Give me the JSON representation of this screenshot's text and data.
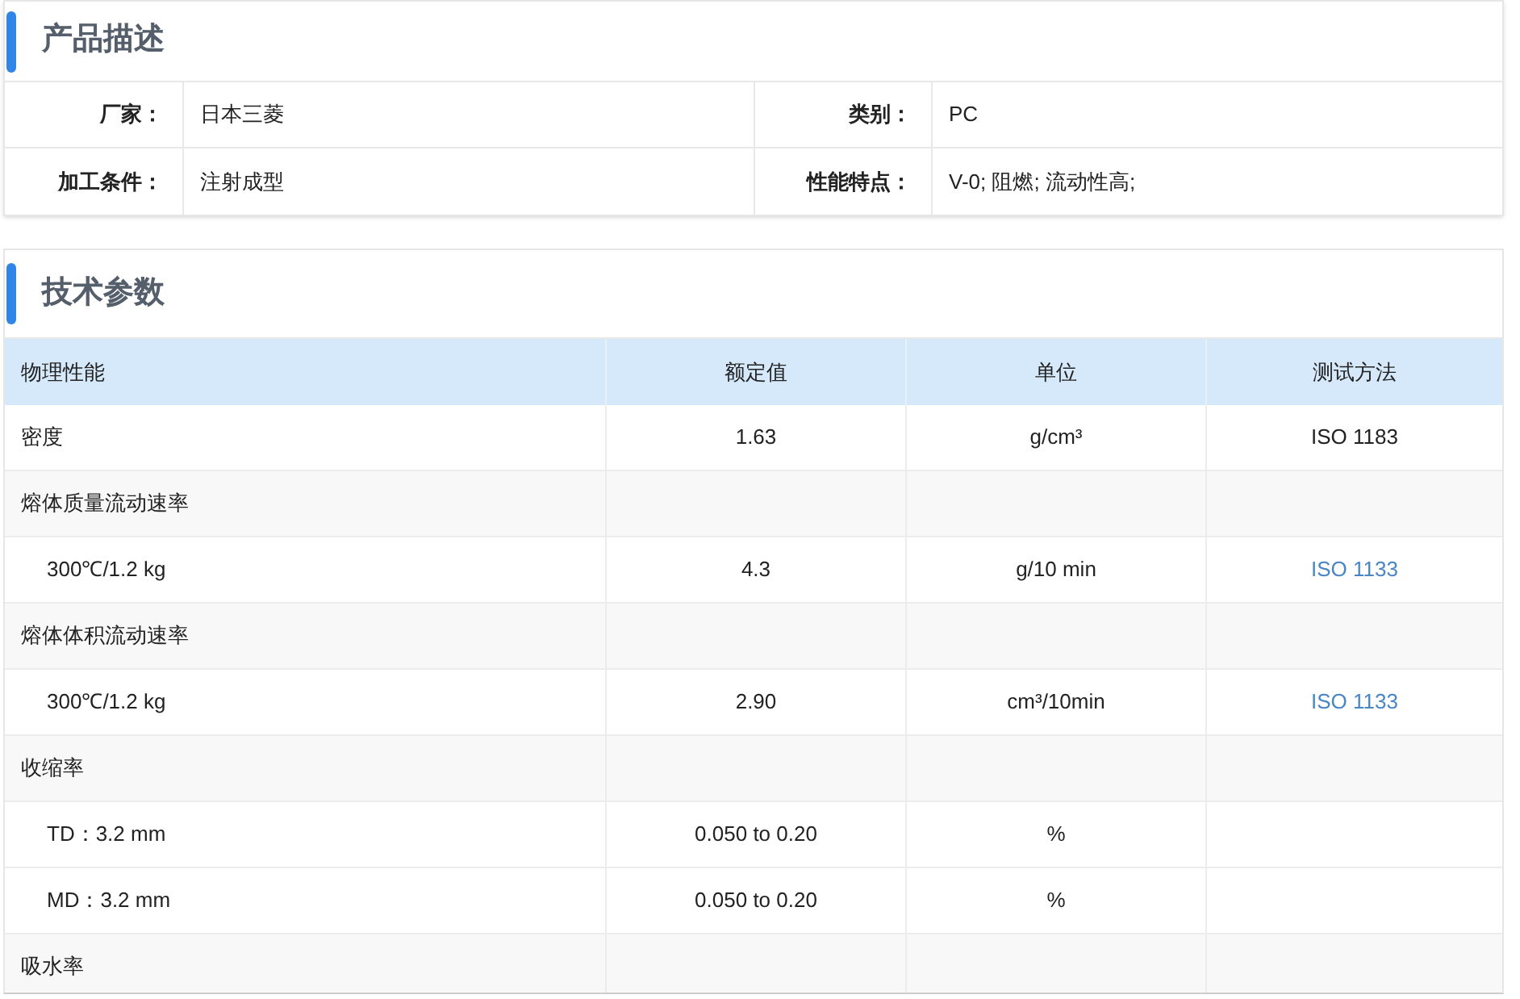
{
  "description": {
    "title": "产品描述",
    "rows": [
      [
        {
          "label": "厂家：",
          "value": "日本三菱"
        },
        {
          "label": "类别：",
          "value": "PC"
        }
      ],
      [
        {
          "label": "加工条件：",
          "value": "注射成型"
        },
        {
          "label": "性能特点：",
          "value": "V-0; 阻燃; 流动性高;"
        }
      ]
    ]
  },
  "parameters": {
    "title": "技术参数",
    "columns": [
      "物理性能",
      "额定值",
      "单位",
      "测试方法"
    ],
    "rows": [
      {
        "kind": "property",
        "cells": [
          "密度",
          "1.63",
          "g/cm³",
          "ISO 1183"
        ],
        "method_link": false
      },
      {
        "kind": "group",
        "cells": [
          "熔体质量流动速率"
        ]
      },
      {
        "kind": "condition",
        "cells": [
          "300℃/1.2 kg",
          "4.3",
          "g/10 min",
          "ISO 1133"
        ],
        "method_link": true
      },
      {
        "kind": "group",
        "cells": [
          "熔体体积流动速率"
        ]
      },
      {
        "kind": "condition",
        "cells": [
          "300℃/1.2 kg",
          "2.90",
          "cm³/10min",
          "ISO 1133"
        ],
        "method_link": true
      },
      {
        "kind": "group",
        "cells": [
          "收缩率"
        ]
      },
      {
        "kind": "condition",
        "cells": [
          "TD：3.2 mm",
          "0.050 to 0.20",
          "%"
        ]
      },
      {
        "kind": "condition",
        "cells": [
          "MD：3.2 mm",
          "0.050 to 0.20",
          "%"
        ]
      },
      {
        "kind": "group",
        "cells": [
          "吸水率"
        ]
      }
    ]
  }
}
